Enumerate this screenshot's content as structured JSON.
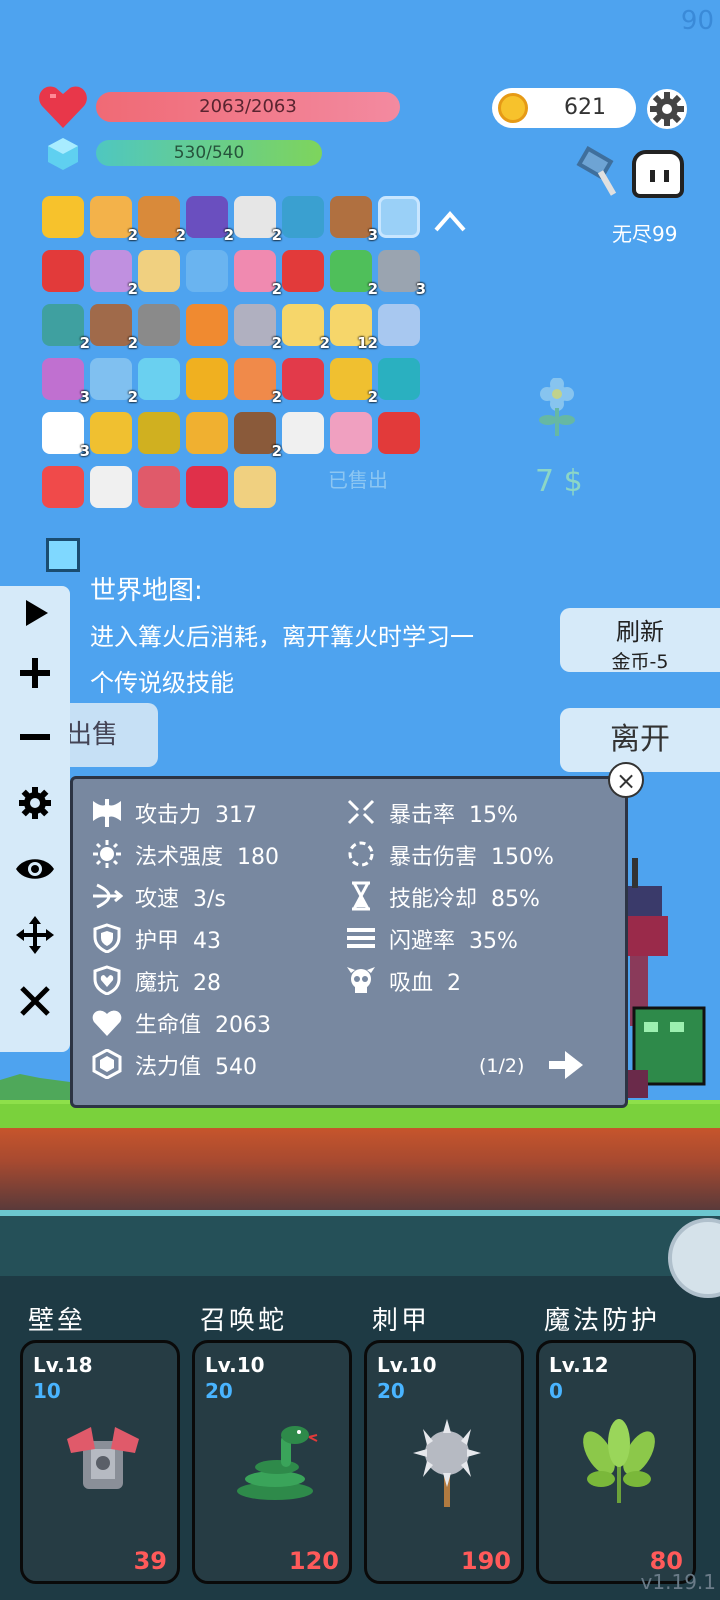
{
  "hud": {
    "fps": "90",
    "hp": "2063/2063",
    "mp": "530/540",
    "gold": "621",
    "mode": "无尽99",
    "hp_fraction": 1.0,
    "mp_fraction": 0.981
  },
  "items": {
    "rows": [
      [
        {
          "icon": "sun-icon",
          "count": ""
        },
        {
          "icon": "scroll-icon",
          "count": "2"
        },
        {
          "icon": "briefcase-icon",
          "count": "2"
        },
        {
          "icon": "wizard-hat-icon",
          "count": "2"
        },
        {
          "icon": "hook-icon",
          "count": "2"
        },
        {
          "icon": "target-icon",
          "count": ""
        },
        {
          "icon": "coconut-drink-icon",
          "count": "3"
        },
        {
          "icon": "empty-slot-icon",
          "count": ""
        }
      ],
      [
        {
          "icon": "bookmark-icon",
          "count": ""
        },
        {
          "icon": "unicorn-icon",
          "count": "2"
        },
        {
          "icon": "map-scroll-icon",
          "count": ""
        },
        {
          "icon": "id-card-icon",
          "count": ""
        },
        {
          "icon": "potion-bottle-icon",
          "count": "2"
        },
        {
          "icon": "magnet-icon",
          "count": ""
        },
        {
          "icon": "money-heart-icon",
          "count": "2"
        },
        {
          "icon": "spiked-mace-icon",
          "count": "3"
        }
      ],
      [
        {
          "icon": "shield-round-icon",
          "count": "2"
        },
        {
          "icon": "tombstone-icon",
          "count": "2"
        },
        {
          "icon": "molecule-icon",
          "count": ""
        },
        {
          "icon": "meteor-icon",
          "count": ""
        },
        {
          "icon": "battle-axe-icon",
          "count": "2"
        },
        {
          "icon": "quill-paper-icon",
          "count": "2"
        },
        {
          "icon": "folded-map-icon",
          "count": "12"
        },
        {
          "icon": "robe-icon",
          "count": ""
        }
      ],
      [
        {
          "icon": "flower-pot-icon",
          "count": "3"
        },
        {
          "icon": "magic-orb-icon",
          "count": "2"
        },
        {
          "icon": "syringe-icon",
          "count": ""
        },
        {
          "icon": "coin-stack-icon",
          "count": ""
        },
        {
          "icon": "rainbow-icon",
          "count": "2"
        },
        {
          "icon": "heart-item-icon",
          "count": ""
        },
        {
          "icon": "pineapple-icon",
          "count": "2"
        },
        {
          "icon": "swirl-tile-icon",
          "count": ""
        }
      ],
      [
        {
          "icon": "ghost-item-icon",
          "count": "3"
        },
        {
          "icon": "crown-icon",
          "count": ""
        },
        {
          "icon": "durian-icon",
          "count": ""
        },
        {
          "icon": "beer-mug-icon",
          "count": ""
        },
        {
          "icon": "pirate-ship-icon",
          "count": "2"
        },
        {
          "icon": "envelope-icon",
          "count": ""
        },
        {
          "icon": "ice-cream-icon",
          "count": ""
        },
        {
          "icon": "strawberry-icon",
          "count": ""
        }
      ],
      [
        {
          "icon": "pill-icon",
          "count": ""
        },
        {
          "icon": "playing-cards-icon",
          "count": ""
        },
        {
          "icon": "armor-chest-icon",
          "count": ""
        },
        {
          "icon": "ruby-icon",
          "count": ""
        },
        {
          "icon": "treasure-map-icon",
          "count": ""
        }
      ]
    ]
  },
  "shop": {
    "sold_label": "已售出",
    "price": "7 $"
  },
  "description": {
    "title": "世界地图:",
    "line1": "进入篝火后消耗，离开篝火时学习一",
    "line2": "个传说级技能"
  },
  "buttons": {
    "refresh": "刷新",
    "refresh_cost": "金币-5",
    "leave": "离开",
    "switch_sell": "切换出售",
    "close": "×"
  },
  "stats": {
    "left": [
      {
        "icon": "axe-icon",
        "label": "攻击力",
        "value": "317"
      },
      {
        "icon": "sun-power-icon",
        "label": "法术强度",
        "value": "180"
      },
      {
        "icon": "bow-icon",
        "label": "攻速",
        "value": "3/s"
      },
      {
        "icon": "shield-icon",
        "label": "护甲",
        "value": "43"
      },
      {
        "icon": "heart-shield-icon",
        "label": "魔抗",
        "value": "28"
      },
      {
        "icon": "heart-icon",
        "label": "生命值",
        "value": "2063"
      },
      {
        "icon": "mana-gem-icon",
        "label": "法力值",
        "value": "540"
      }
    ],
    "right": [
      {
        "icon": "crit-icon",
        "label": "暴击率",
        "value": "15%"
      },
      {
        "icon": "crit-damage-icon",
        "label": "暴击伤害",
        "value": "150%"
      },
      {
        "icon": "hourglass-icon",
        "label": "技能冷却",
        "value": "85%"
      },
      {
        "icon": "dodge-icon",
        "label": "闪避率",
        "value": "35%"
      },
      {
        "icon": "skull-icon",
        "label": "吸血",
        "value": "2"
      }
    ],
    "page": "(1/2)"
  },
  "skills": [
    {
      "name": "壁垒",
      "level": "Lv.18",
      "points": "10",
      "cost": "39"
    },
    {
      "name": "召唤蛇",
      "level": "Lv.10",
      "points": "20",
      "cost": "120"
    },
    {
      "name": "刺甲",
      "level": "Lv.10",
      "points": "20",
      "cost": "190"
    },
    {
      "name": "魔法防护",
      "level": "Lv.12",
      "points": "0",
      "cost": "80"
    }
  ],
  "version": "v1.19.1",
  "colors": {
    "sky": "#4ea3ef",
    "hp": "#f06a75",
    "mp": "#7ed45c",
    "panel": "#7888a0",
    "cost": "#ff5a5a",
    "points": "#49b4ff"
  }
}
